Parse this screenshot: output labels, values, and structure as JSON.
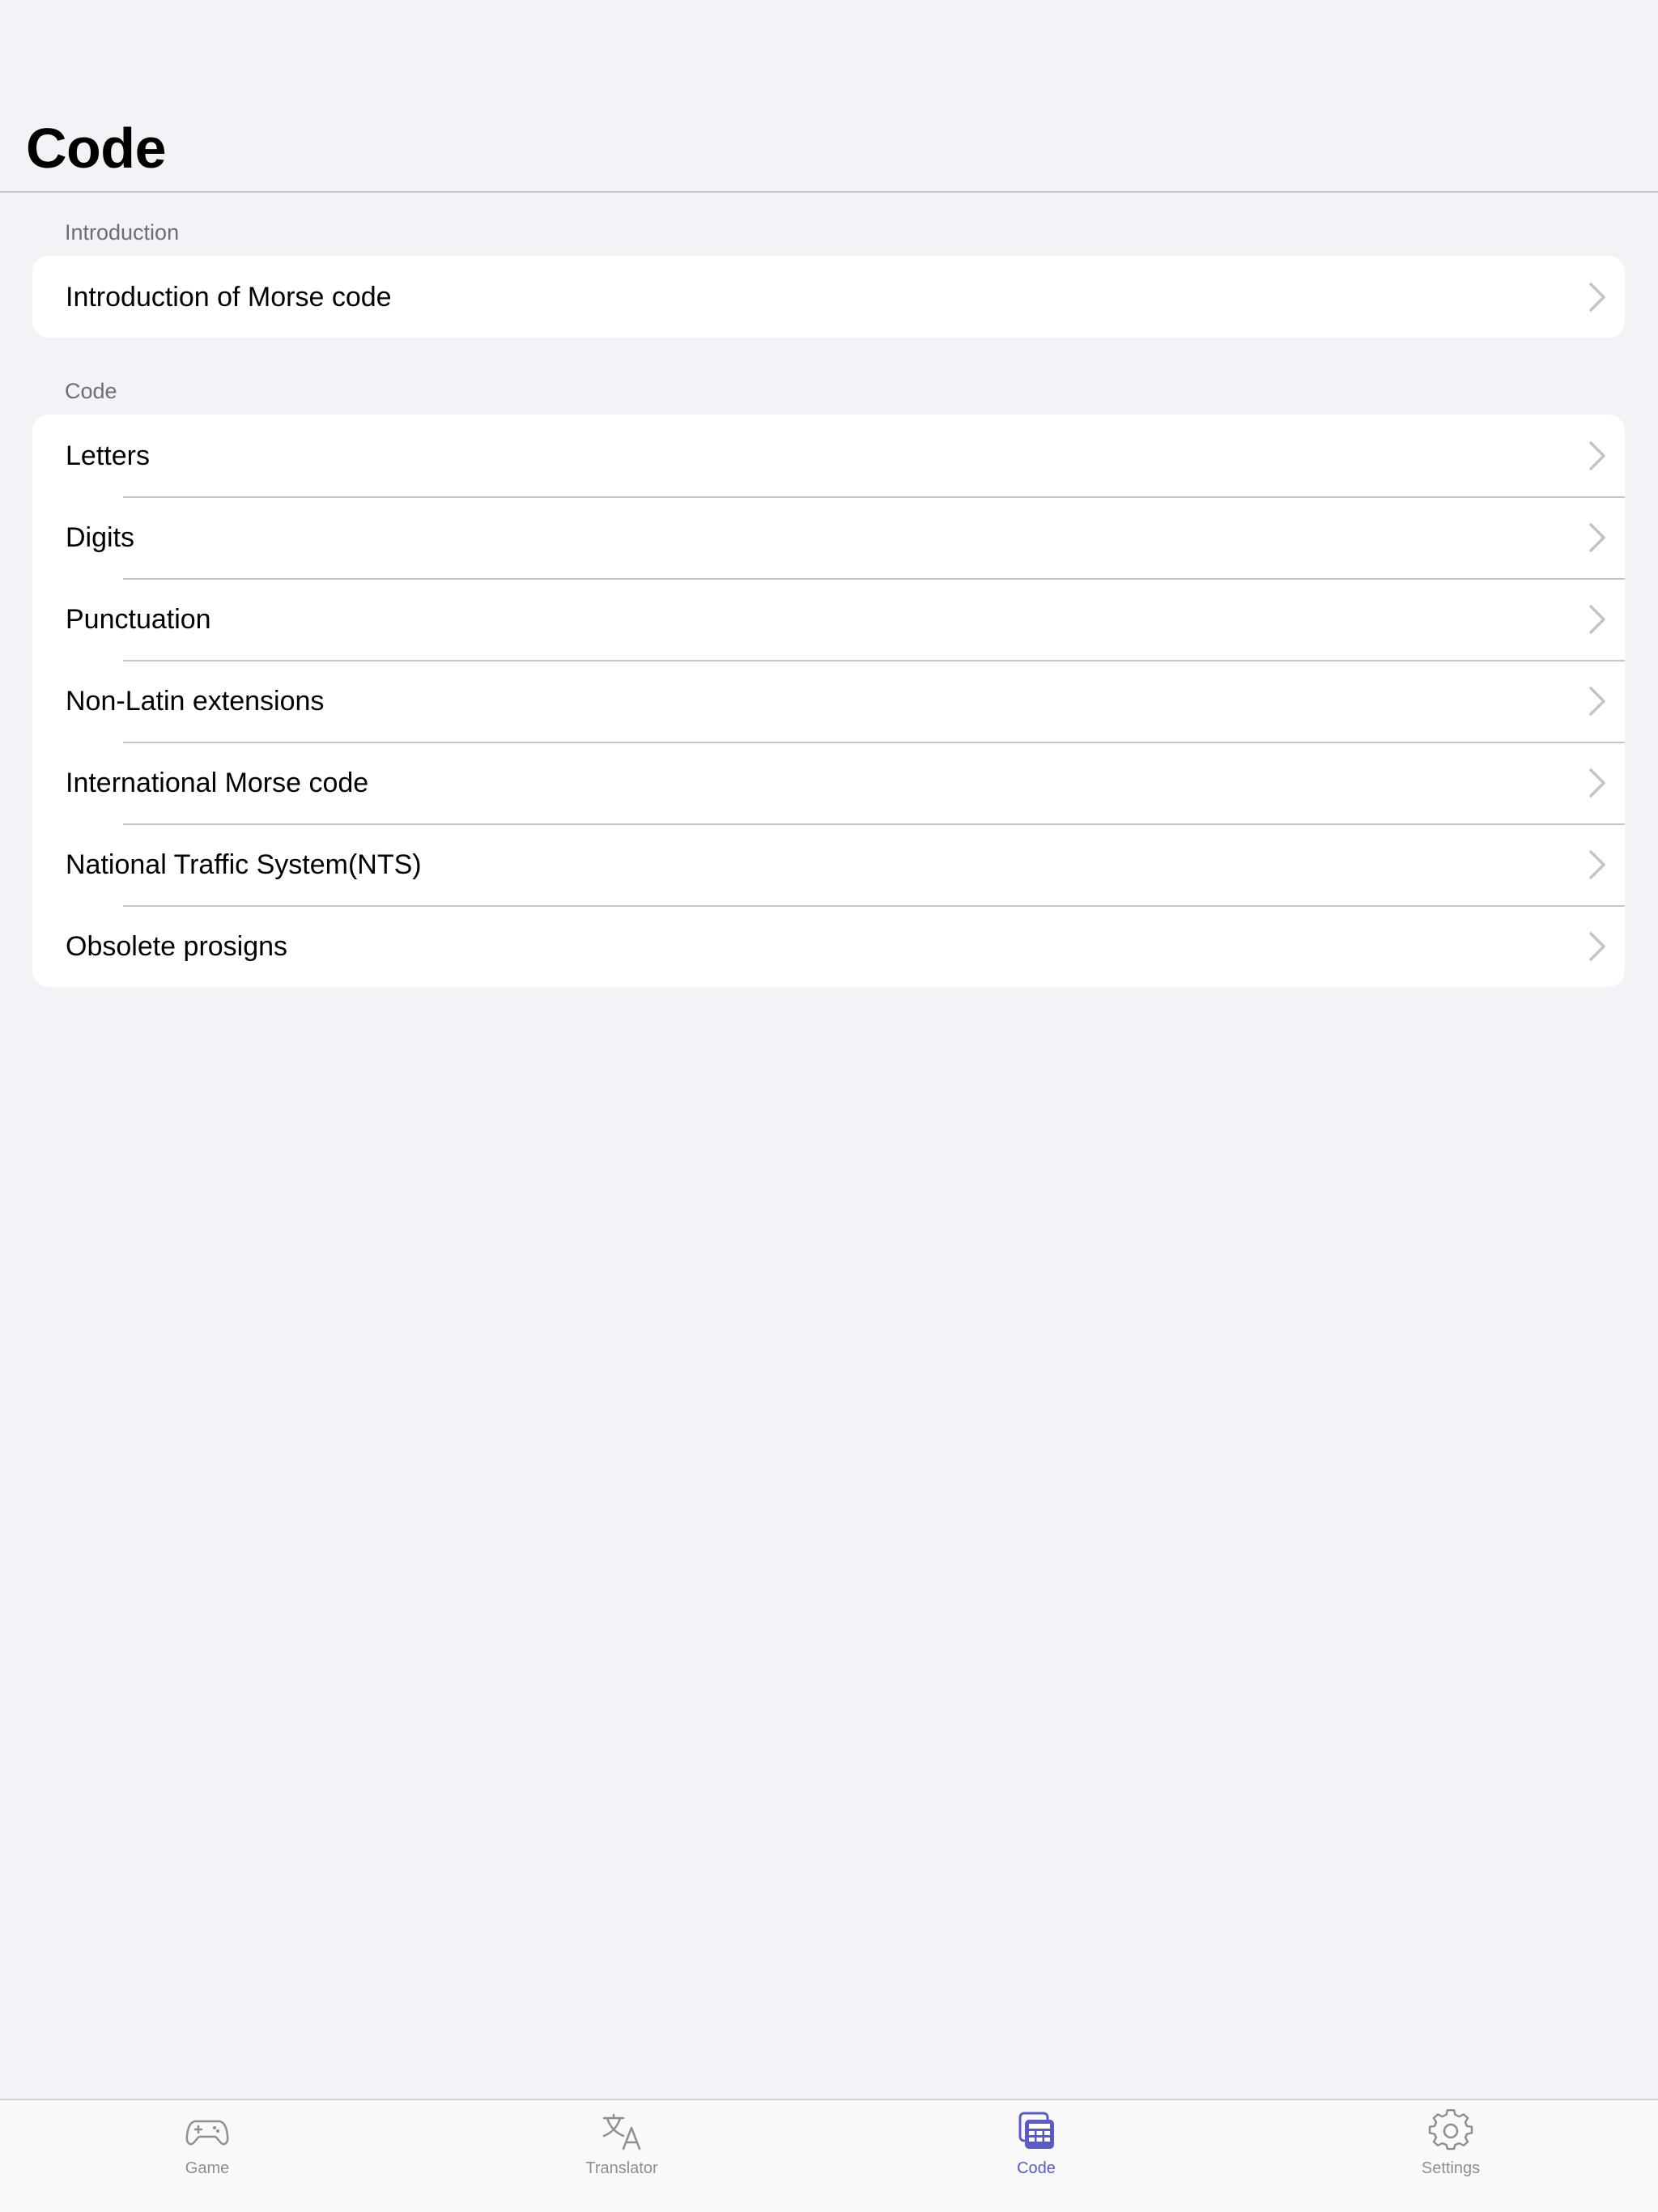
{
  "header": {
    "title": "Code"
  },
  "sections": [
    {
      "header": "Introduction",
      "rows": [
        {
          "label": "Introduction of Morse code"
        }
      ]
    },
    {
      "header": "Code",
      "rows": [
        {
          "label": "Letters"
        },
        {
          "label": "Digits"
        },
        {
          "label": "Punctuation"
        },
        {
          "label": "Non-Latin extensions"
        },
        {
          "label": "International Morse code"
        },
        {
          "label": "National Traffic System(NTS)"
        },
        {
          "label": "Obsolete prosigns"
        }
      ]
    }
  ],
  "row_accessory_icon": "chevron-right-icon",
  "tabbar": {
    "active_index": 2,
    "tabs": [
      {
        "label": "Game",
        "icon": "gamecontroller-icon"
      },
      {
        "label": "Translator",
        "icon": "translate-icon"
      },
      {
        "label": "Code",
        "icon": "code-table-icon"
      },
      {
        "label": "Settings",
        "icon": "gear-icon"
      }
    ]
  },
  "colors": {
    "background": "#f2f2f7",
    "card": "#ffffff",
    "separator": "#c6c6c8",
    "section_header_text": "#6d6d72",
    "chevron": "#c4c4c7",
    "tab_inactive": "#8e8e93",
    "tab_active": "#5b5bc7"
  }
}
